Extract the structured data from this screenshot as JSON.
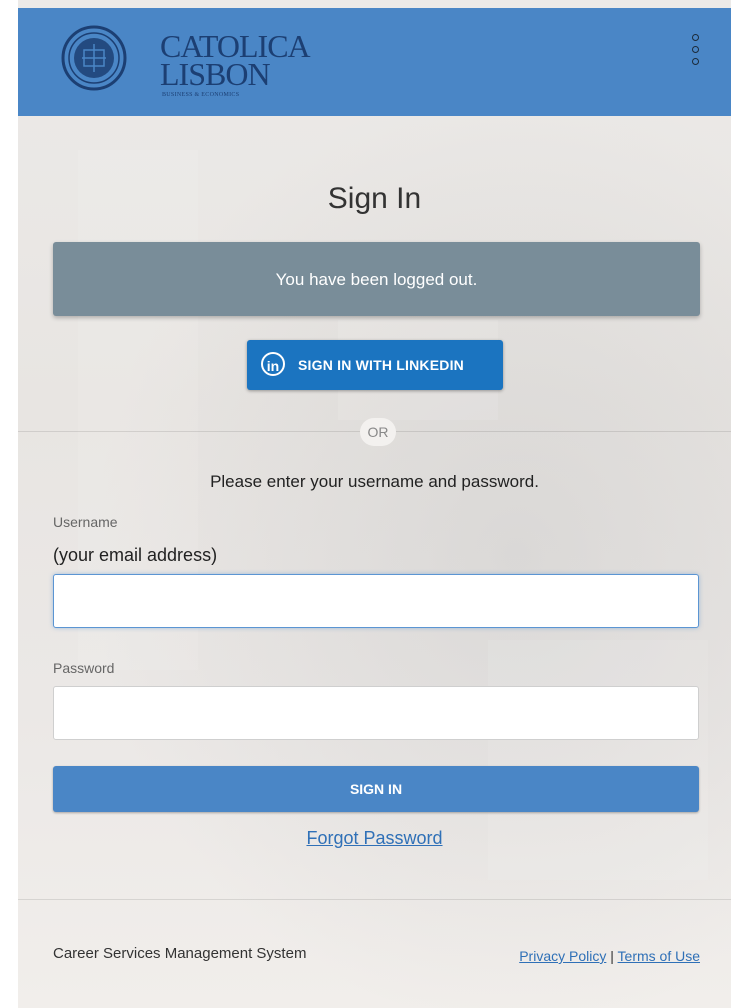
{
  "header": {
    "logo": {
      "line1": "CATOLICA",
      "line2": "LISBON",
      "line3": "BUSINESS & ECONOMICS",
      "emblem_icon": "university-seal-icon"
    },
    "menu_icon": "vertical-dots-icon",
    "bg_color": "#4a86c6"
  },
  "main": {
    "title": "Sign In",
    "alert_message": "You have been logged out.",
    "linkedin_button": {
      "label": "SIGN IN WITH LINKEDIN",
      "icon": "linkedin-icon",
      "icon_text": "in",
      "color": "#1b74c0"
    },
    "or_label": "OR",
    "instructions": "Please enter your username and password.",
    "username": {
      "label": "Username",
      "sublabel": "(your email address)",
      "value": "",
      "placeholder": ""
    },
    "password": {
      "label": "Password",
      "value": "",
      "placeholder": ""
    },
    "signin_button": "SIGN IN",
    "forgot_link": "Forgot Password"
  },
  "footer": {
    "system_name": "Career Services Management System",
    "privacy_link": "Privacy Policy",
    "separator": "|",
    "terms_link": "Terms of Use"
  }
}
